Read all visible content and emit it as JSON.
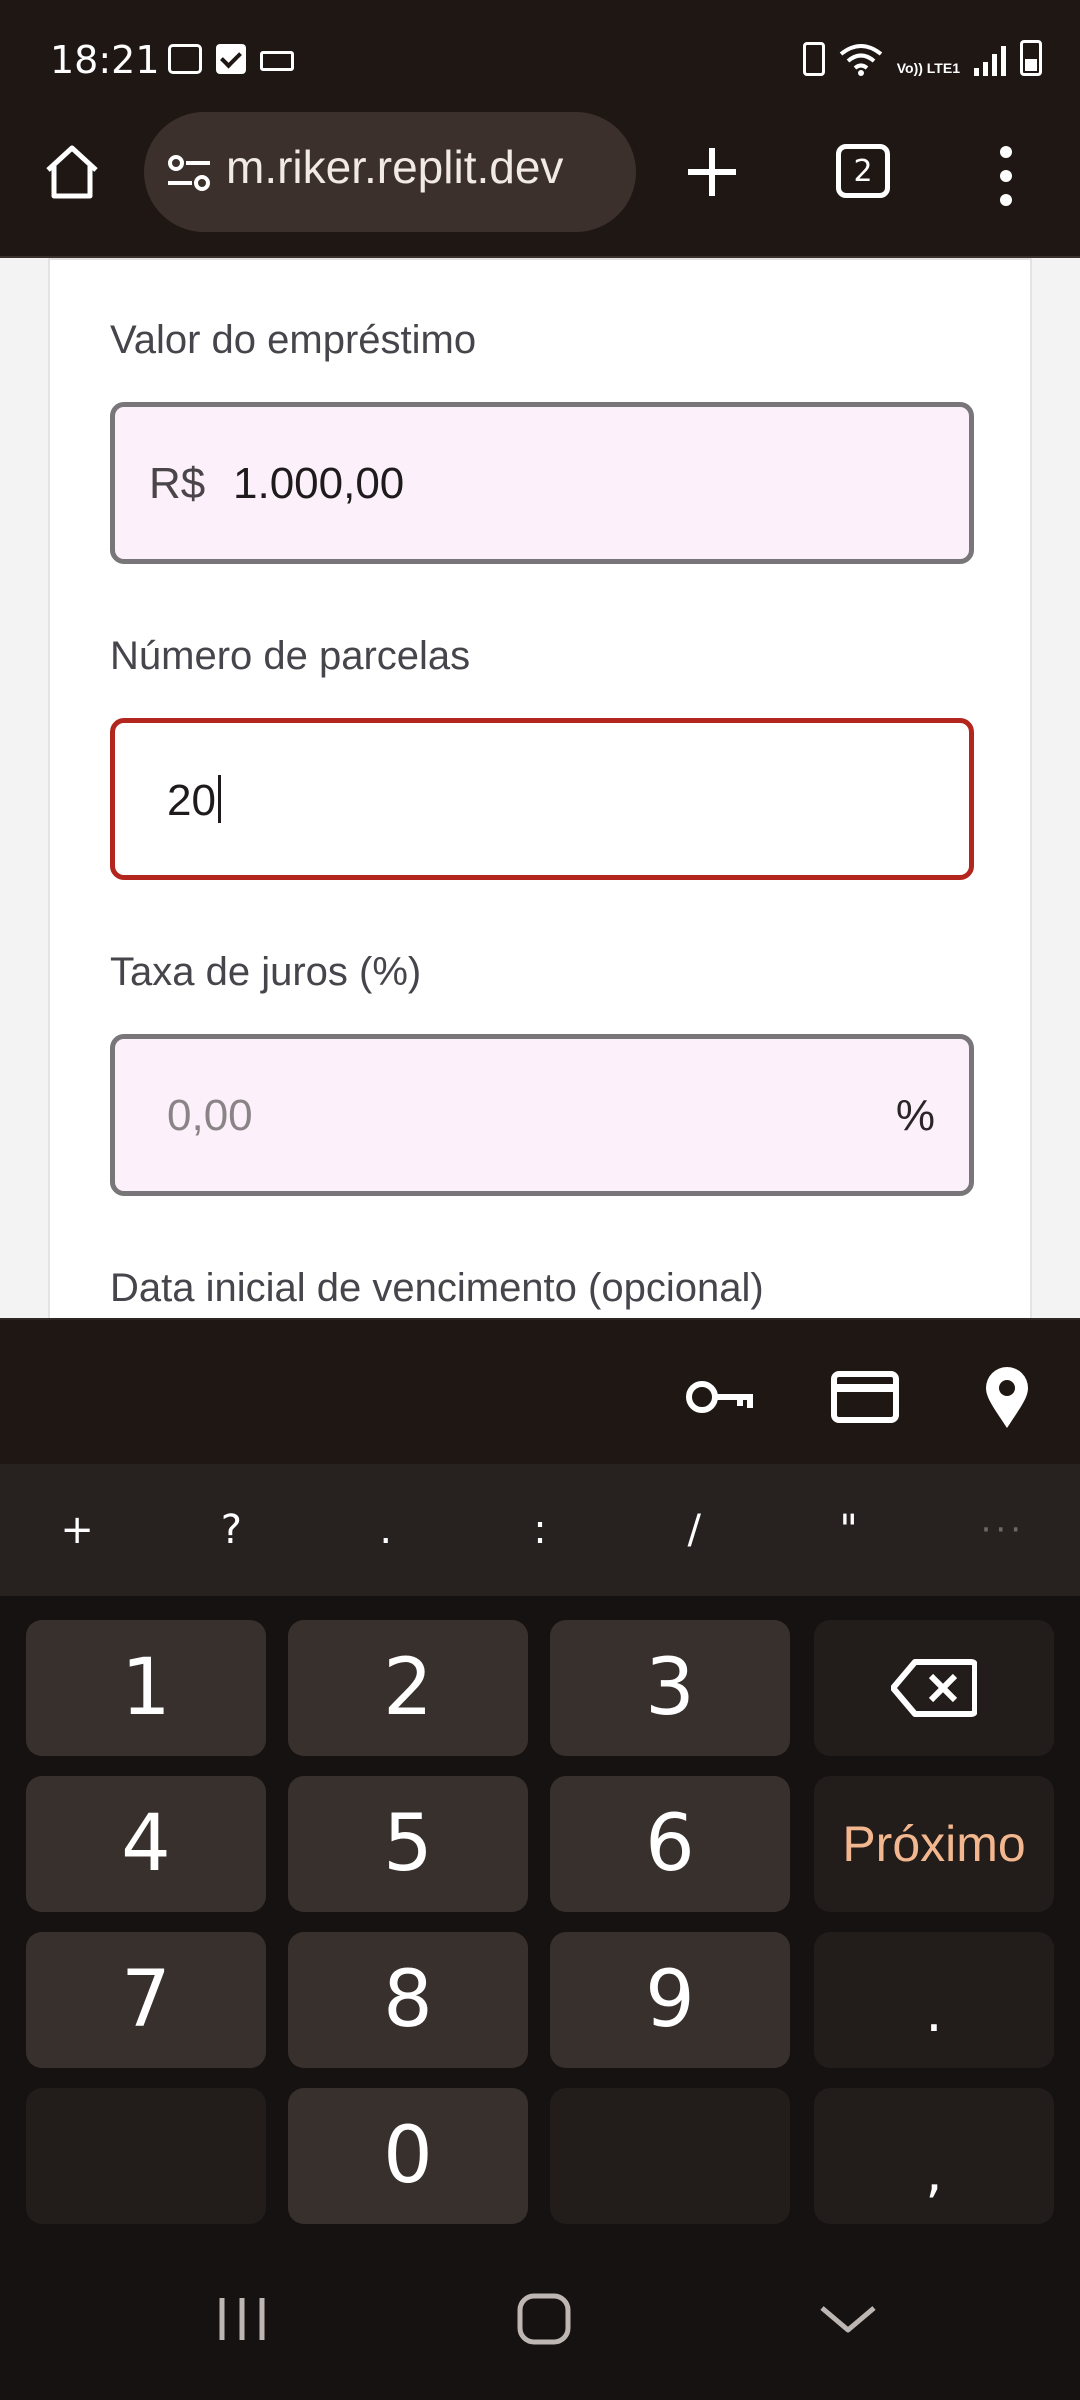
{
  "status_bar": {
    "time": "18:21",
    "network": "Vo)) LTE1",
    "icons": [
      "voicemail-icon",
      "check-box-icon",
      "keyboard-icon",
      "battery-saver-icon",
      "wifi-icon",
      "signal-icon",
      "battery-charging-icon"
    ]
  },
  "browser": {
    "url": "m.riker.replit.dev",
    "tab_count": "2",
    "icons": [
      "home-icon",
      "site-settings-icon",
      "new-tab-plus-icon",
      "tab-switcher-icon",
      "more-menu-icon"
    ]
  },
  "form": {
    "loan_amount": {
      "label": "Valor do empréstimo",
      "prefix": "R$",
      "value": "1.000,00"
    },
    "installments": {
      "label": "Número de parcelas",
      "value": "20"
    },
    "interest_rate": {
      "label": "Taxa de juros (%)",
      "placeholder": "0,00",
      "suffix": "%"
    },
    "start_date": {
      "label": "Data inicial de vencimento (opcional)"
    }
  },
  "keyboard": {
    "toolbar_icons": [
      "key-icon",
      "credit-card-icon",
      "location-pin-icon"
    ],
    "symbols": [
      "+",
      "?",
      ".",
      ":",
      "/",
      "\"",
      "···"
    ],
    "keys": {
      "k1": "1",
      "k2": "2",
      "k3": "3",
      "k4": "4",
      "k5": "5",
      "k6": "6",
      "k7": "7",
      "k8": "8",
      "k9": "9",
      "k0": "0",
      "period": ".",
      "comma": ",",
      "next": "Próximo"
    }
  },
  "navigation_bar": {
    "icons": [
      "recent-apps-icon",
      "home-circle-icon",
      "hide-keyboard-icon"
    ]
  }
}
